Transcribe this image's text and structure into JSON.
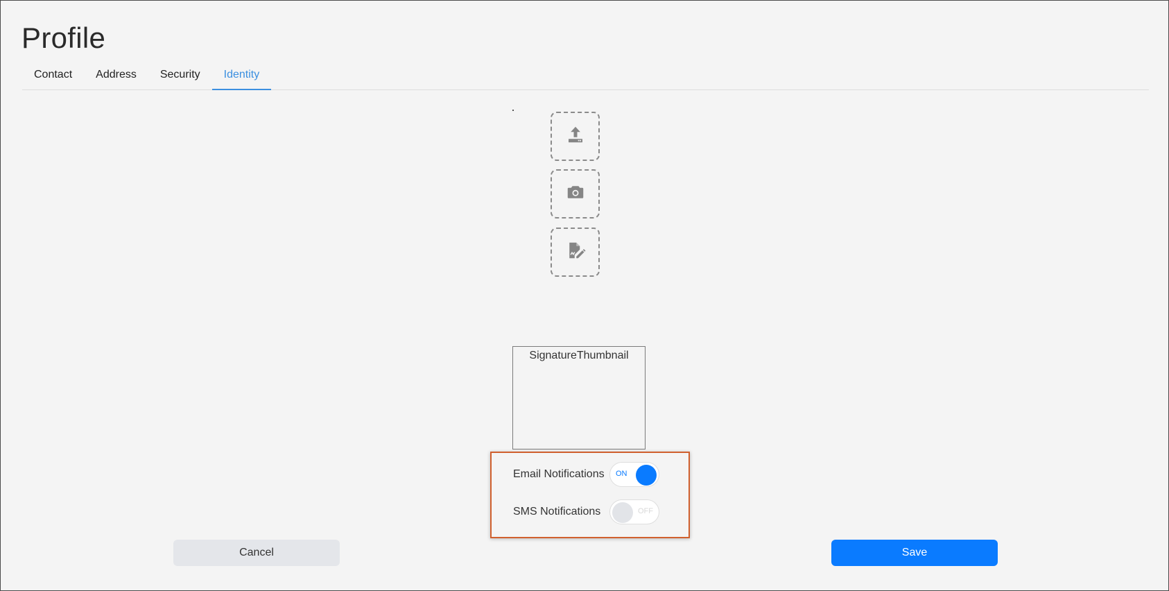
{
  "page": {
    "title": "Profile"
  },
  "tabs": [
    {
      "label": "Contact",
      "active": false
    },
    {
      "label": "Address",
      "active": false
    },
    {
      "label": "Security",
      "active": false
    },
    {
      "label": "Identity",
      "active": true
    }
  ],
  "identity": {
    "actions": [
      {
        "icon": "upload-icon"
      },
      {
        "icon": "camera-icon"
      },
      {
        "icon": "signature-icon"
      }
    ],
    "signature_thumbnail_label": "SignatureThumbnail"
  },
  "notifications": {
    "email": {
      "label": "Email Notifications",
      "state": "ON",
      "enabled": true
    },
    "sms": {
      "label": "SMS Notifications",
      "state": "OFF",
      "enabled": false
    }
  },
  "footer": {
    "cancel_label": "Cancel",
    "save_label": "Save"
  },
  "colors": {
    "accent": "#0a7bff",
    "tab_active": "#3b8fe0",
    "highlight_border": "#d0602e"
  }
}
